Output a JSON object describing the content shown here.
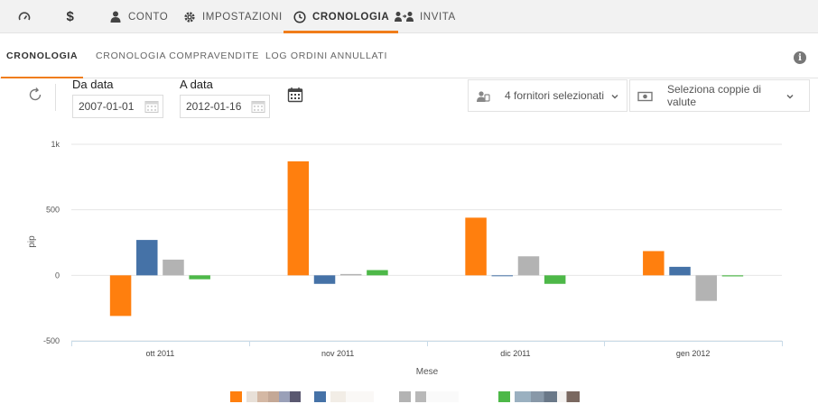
{
  "topnav": {
    "items": [
      {
        "key": "dashboard",
        "label": "",
        "icon": "speedometer-icon"
      },
      {
        "key": "money",
        "label": "",
        "icon": "dollar-icon"
      },
      {
        "key": "account",
        "label": "CONTO",
        "icon": "user-icon"
      },
      {
        "key": "settings",
        "label": "IMPOSTAZIONI",
        "icon": "gear-icon"
      },
      {
        "key": "history",
        "label": "CRONOLOGIA",
        "icon": "clock-icon",
        "active": true
      },
      {
        "key": "invite",
        "label": "INVITA",
        "icon": "invite-users-icon"
      }
    ]
  },
  "subtabs": [
    {
      "label": "CRONOLOGIA",
      "active": true
    },
    {
      "label": "CRONOLOGIA COMPRAVENDITE",
      "active": false
    },
    {
      "label": "LOG ORDINI ANNULLATI",
      "active": false
    }
  ],
  "filters": {
    "from_label": "Da data",
    "from_value": "2007-01-01",
    "to_label": "A data",
    "to_value": "2012-01-16",
    "providers_text": "4 fornitori selezionati",
    "pairs_text": "Seleziona coppie di valute"
  },
  "colors": {
    "accent": "#f07d1a",
    "series": [
      "#ff7f0e",
      "#4572a7",
      "#b3b3b3",
      "#4db848"
    ]
  },
  "chart_data": {
    "type": "bar",
    "title": "",
    "xlabel": "Mese",
    "ylabel": "pip",
    "categories": [
      "ott 2011",
      "nov 2011",
      "dic 2011",
      "gen 2012"
    ],
    "ylim": [
      -500,
      1000
    ],
    "yticks": [
      -500,
      0,
      500,
      1000
    ],
    "ytick_labels": [
      "-500",
      "0",
      "500",
      "1k"
    ],
    "grid": true,
    "legend": "bottom",
    "series": [
      {
        "values": [
          -310,
          870,
          440,
          185
        ]
      },
      {
        "values": [
          270,
          -65,
          0,
          65
        ]
      },
      {
        "values": [
          120,
          10,
          145,
          -195
        ]
      },
      {
        "values": [
          -30,
          40,
          -65,
          -8
        ]
      }
    ]
  }
}
